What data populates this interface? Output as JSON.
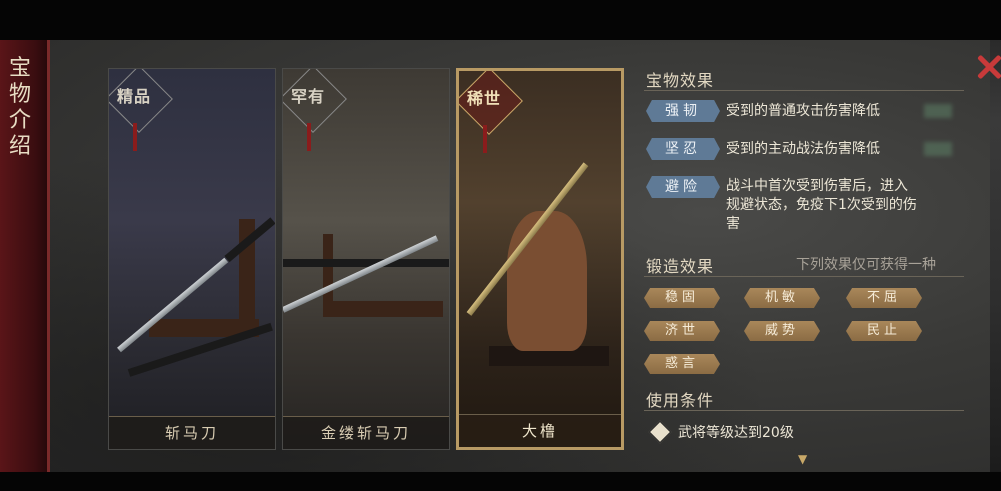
{
  "title": "宝物介绍",
  "cards": [
    {
      "grade": "精品",
      "name": "斩马刀"
    },
    {
      "grade": "罕有",
      "name": "金缕斩马刀"
    },
    {
      "grade": "稀世",
      "name": "大橹"
    }
  ],
  "treasure_effect": {
    "title": "宝物效果",
    "items": [
      {
        "tag": "强韧",
        "text": "受到的普通攻击伤害降低"
      },
      {
        "tag": "坚忍",
        "text": "受到的主动战法伤害降低"
      },
      {
        "tag": "避险",
        "text_line1": "战斗中首次受到伤害后，进入",
        "text_line2": "规避状态，免疫下1次受到的伤",
        "text_line3": "害"
      }
    ]
  },
  "forge_effect": {
    "title": "锻造效果",
    "note": "下列效果仅可获得一种",
    "tags": [
      "稳固",
      "机敏",
      "不屈",
      "济世",
      "威势",
      "民止",
      "惑言"
    ]
  },
  "use_condition": {
    "title": "使用条件",
    "text": "武将等级达到20级"
  },
  "colors": {
    "effect_tag": "#5f7a96",
    "forge_tag": "#9a7a4e",
    "close": "#c83a3a",
    "title_strip": "#4a1214"
  }
}
